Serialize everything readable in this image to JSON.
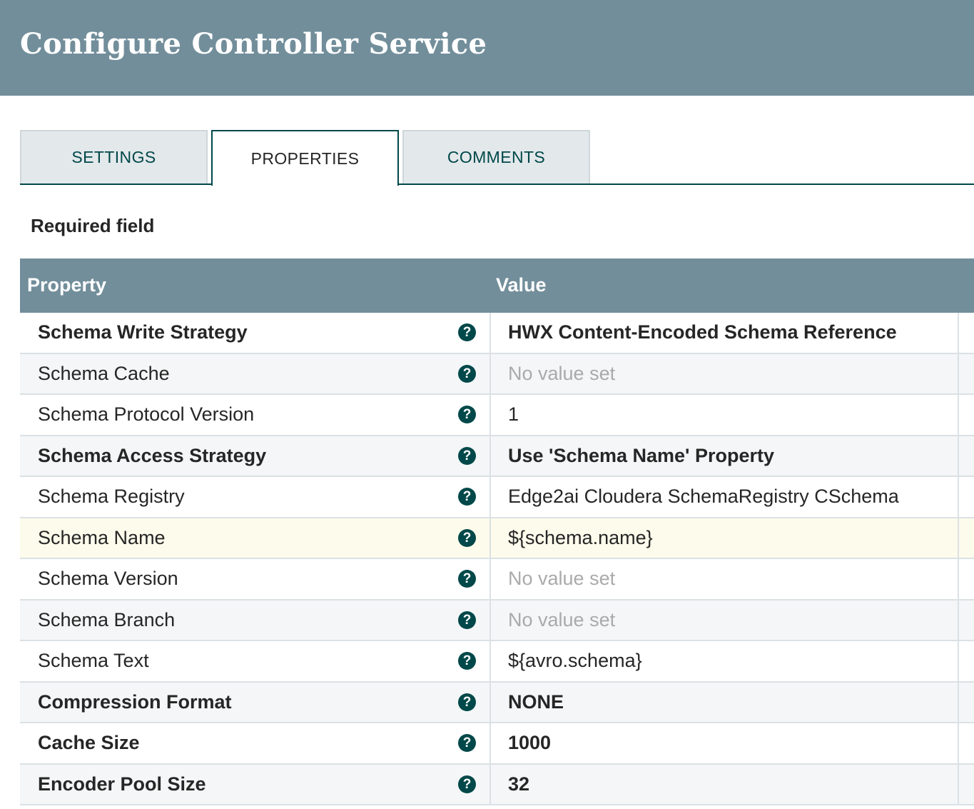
{
  "dialog": {
    "title": "Configure Controller Service"
  },
  "tabs": [
    {
      "label": "SETTINGS",
      "active": false
    },
    {
      "label": "PROPERTIES",
      "active": true
    },
    {
      "label": "COMMENTS",
      "active": false
    }
  ],
  "required_label": "Required field",
  "grid": {
    "headers": {
      "property": "Property",
      "value": "Value"
    },
    "help_glyph": "?",
    "rows": [
      {
        "name": "Schema Write Strategy",
        "value": "HWX Content-Encoded Schema Reference",
        "required": true,
        "unset": false
      },
      {
        "name": "Schema Cache",
        "value": "No value set",
        "required": false,
        "unset": true
      },
      {
        "name": "Schema Protocol Version",
        "value": "1",
        "required": false,
        "unset": false
      },
      {
        "name": "Schema Access Strategy",
        "value": "Use 'Schema Name' Property",
        "required": true,
        "unset": false
      },
      {
        "name": "Schema Registry",
        "value": "Edge2ai Cloudera SchemaRegistry CSchema",
        "required": false,
        "unset": false
      },
      {
        "name": "Schema Name",
        "value": "${schema.name}",
        "required": false,
        "unset": false,
        "selected": true
      },
      {
        "name": "Schema Version",
        "value": "No value set",
        "required": false,
        "unset": true
      },
      {
        "name": "Schema Branch",
        "value": "No value set",
        "required": false,
        "unset": true
      },
      {
        "name": "Schema Text",
        "value": "${avro.schema}",
        "required": false,
        "unset": false
      },
      {
        "name": "Compression Format",
        "value": "NONE",
        "required": true,
        "unset": false
      },
      {
        "name": "Cache Size",
        "value": "1000",
        "required": true,
        "unset": false
      },
      {
        "name": "Encoder Pool Size",
        "value": "32",
        "required": true,
        "unset": false
      }
    ]
  },
  "colors": {
    "header_bg": "#728e9b",
    "accent": "#004849",
    "selected_row": "#fdfbeb",
    "unset_text": "#aaaaaa"
  }
}
